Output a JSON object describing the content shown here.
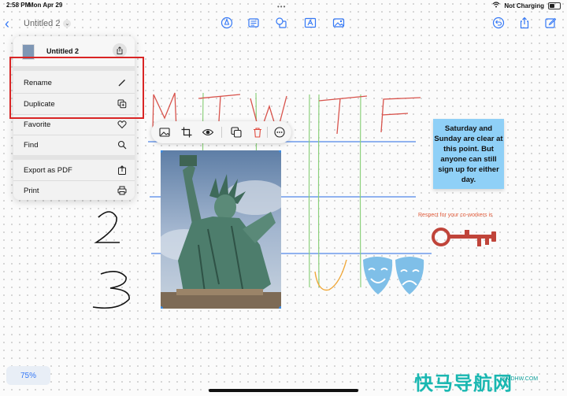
{
  "status": {
    "time": "2:58 PM",
    "date": "Mon Apr 29",
    "network": "Not Charging"
  },
  "toolbar": {
    "title": "Untitled 2",
    "icons": [
      "pen-tip-icon",
      "text-box-icon",
      "shapes-icon",
      "text-icon",
      "media-icon",
      "undo-icon",
      "share-icon",
      "compose-icon"
    ]
  },
  "menu": {
    "header_title": "Untitled 2",
    "items": [
      {
        "label": "Rename",
        "icon": "pencil-icon"
      },
      {
        "label": "Duplicate",
        "icon": "duplicate-icon"
      },
      {
        "label": "Favorite",
        "icon": "heart-icon"
      },
      {
        "label": "Find",
        "icon": "magnifier-icon"
      },
      {
        "label": "Export as PDF",
        "icon": "export-icon"
      },
      {
        "label": "Print",
        "icon": "printer-icon"
      }
    ]
  },
  "image_toolbar": {
    "icons": [
      "photo-icon",
      "crop-icon",
      "eye-icon",
      "duplicate-icon",
      "trash-icon",
      "more-icon"
    ]
  },
  "board": {
    "sticky_note": "Saturday and Sunday are clear at this point. But anyone can still sign up for either day.",
    "caption": "Respect for your co-workers is",
    "handwriting_letters": [
      "M",
      "T",
      "W",
      "T",
      "F"
    ],
    "handwriting_numbers": [
      "2",
      "3"
    ],
    "colors": {
      "accent": "#3478f6",
      "sticky": "#8fd0f7",
      "highlight": "#d92525",
      "key": "#c0443a",
      "masks": "#7fbfe8"
    }
  },
  "zoom": "75%",
  "watermark": {
    "text": "快马导航网",
    "sub": "KMDHW.COM"
  }
}
